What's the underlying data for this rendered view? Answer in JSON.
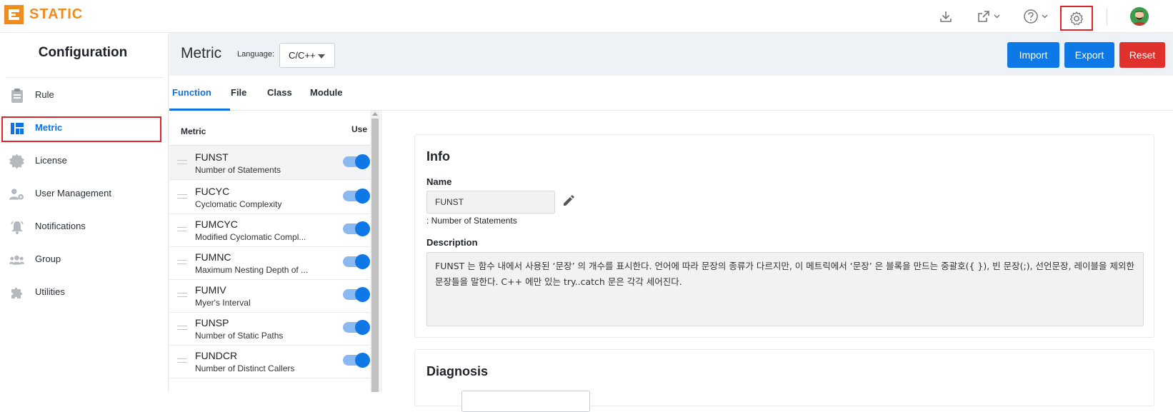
{
  "app": {
    "logo_text": "STATIC",
    "brand_color": "#f08c1e",
    "accent": "#0d72e4",
    "danger": "#e0322c"
  },
  "topbar": {
    "icons": [
      "download-icon",
      "external-link-icon",
      "help-icon",
      "settings-icon",
      "user-avatar"
    ]
  },
  "sidebar": {
    "title": "Configuration",
    "items": [
      {
        "label": "Rule",
        "icon": "clipboard-icon"
      },
      {
        "label": "Metric",
        "icon": "dashboard-icon",
        "active": true
      },
      {
        "label": "License",
        "icon": "badge-icon"
      },
      {
        "label": "User Management",
        "icon": "user-gear-icon"
      },
      {
        "label": "Notifications",
        "icon": "bell-icon"
      },
      {
        "label": "Group",
        "icon": "group-icon"
      },
      {
        "label": "Utilities",
        "icon": "puzzle-icon"
      }
    ]
  },
  "header": {
    "title": "Metric",
    "language_label": "Language:",
    "language_value": "C/C++",
    "import_label": "Import",
    "export_label": "Export",
    "reset_label": "Reset"
  },
  "tabs": [
    "Function",
    "File",
    "Class",
    "Module"
  ],
  "metric_list": {
    "col_metric": "Metric",
    "col_use": "Use",
    "rows": [
      {
        "code": "FUNST",
        "desc": "Number of Statements",
        "use": true
      },
      {
        "code": "FUCYC",
        "desc": "Cyclomatic Complexity",
        "use": true
      },
      {
        "code": "FUMCYC",
        "desc": "Modified Cyclomatic Compl...",
        "use": true
      },
      {
        "code": "FUMNC",
        "desc": "Maximum Nesting Depth of ...",
        "use": true
      },
      {
        "code": "FUMIV",
        "desc": "Myer's Interval",
        "use": true
      },
      {
        "code": "FUNSP",
        "desc": "Number of Static Paths",
        "use": true
      },
      {
        "code": "FUNDCR",
        "desc": "Number of Distinct Callers",
        "use": true
      }
    ]
  },
  "info": {
    "title": "Info",
    "name_label": "Name",
    "name_value": "FUNST",
    "name_sub": ": Number of Statements",
    "description_label": "Description",
    "description_text": "FUNST 는 함수 내에서 사용된 ‘문장’ 의 개수를 표시한다. 언어에 따라 문장의 종류가 다르지만, 이 메트릭에서 ‘문장’ 은 블록을 만드는 중괄호({ }), 빈 문장(;), 선언문장, 레이블을 제외한 문장들을 말한다. C++ 에만 있는 try..catch 문은 각각 세어진다."
  },
  "diagnosis": {
    "title": "Diagnosis"
  }
}
